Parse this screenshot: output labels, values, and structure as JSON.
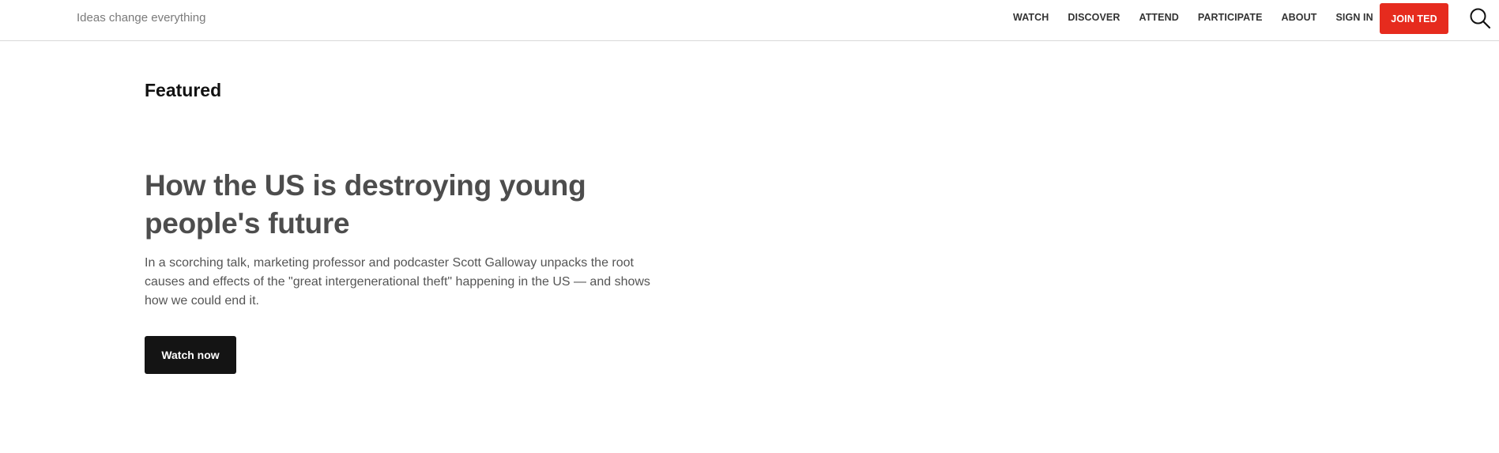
{
  "header": {
    "tagline": "Ideas change everything",
    "nav": [
      {
        "label": "WATCH"
      },
      {
        "label": "DISCOVER"
      },
      {
        "label": "ATTEND"
      },
      {
        "label": "PARTICIPATE"
      },
      {
        "label": "ABOUT"
      },
      {
        "label": "SIGN IN"
      }
    ],
    "join_label": "JOIN TED",
    "search_icon": "search-icon"
  },
  "featured": {
    "section_title": "Featured",
    "headline": "How the US is destroying young people's future",
    "description": "In a scorching talk, marketing professor and podcaster Scott Galloway unpacks the root causes and effects of the \"great intergenerational theft\" happening in the US — and shows how we could end it.",
    "cta_label": "Watch now"
  },
  "colors": {
    "brand_red": "#e62b1e",
    "cta_dark": "#141414",
    "headline_gray": "#4d4d4d"
  }
}
